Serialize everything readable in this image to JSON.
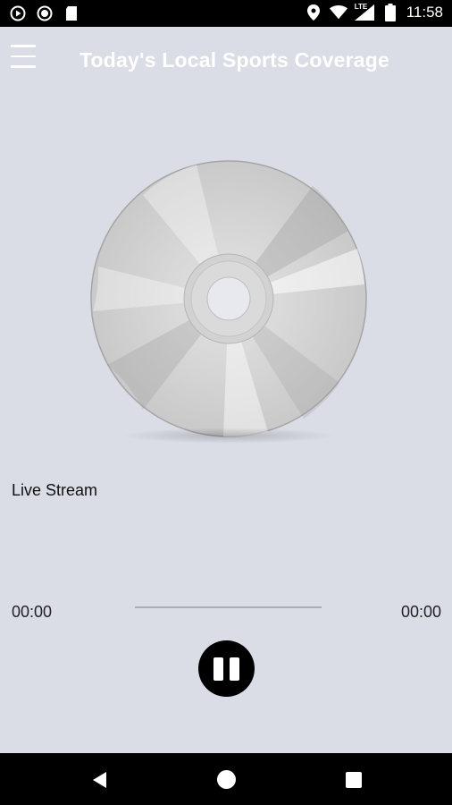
{
  "status_bar": {
    "time": "11:58",
    "network_label": "LTE",
    "icons": [
      "play-circle-icon",
      "record-icon",
      "sd-card-icon",
      "location-icon",
      "wifi-icon",
      "signal-icon",
      "battery-icon"
    ]
  },
  "app_bar": {
    "title": "Today's Local Sports Coverage",
    "menu_icon": "hamburger-icon"
  },
  "player": {
    "artwork_icon": "cd-disc-icon",
    "stream_label": "Live Stream",
    "elapsed": "00:00",
    "duration": "00:00",
    "progress": 0,
    "control_icon": "pause-icon"
  },
  "nav_bar": {
    "icons": [
      "back-icon",
      "home-icon",
      "recents-icon"
    ]
  },
  "colors": {
    "background": "#dadde6",
    "bars": "#000000",
    "title": "#ffffff"
  }
}
